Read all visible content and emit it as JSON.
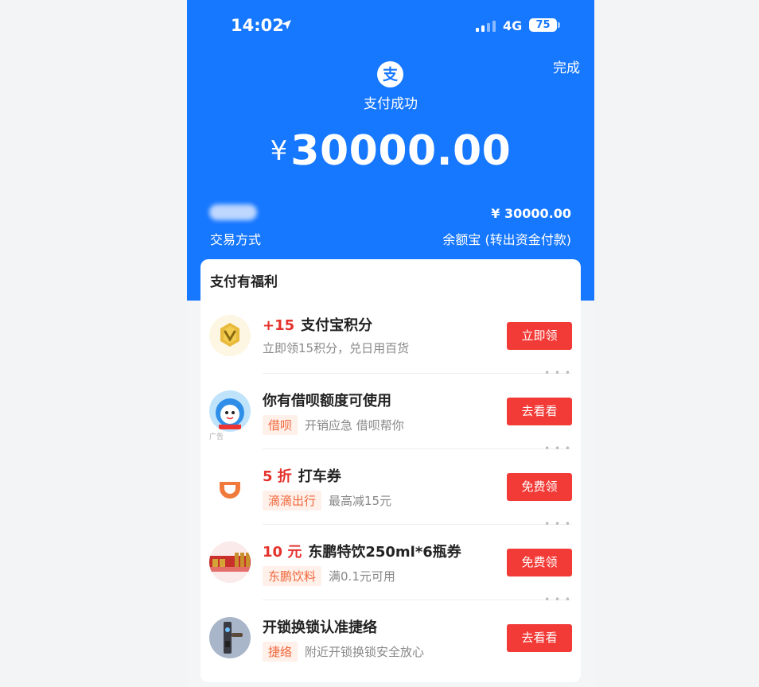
{
  "status_bar": {
    "time": "14:02",
    "network": "4G",
    "battery": "75"
  },
  "header": {
    "done_label": "完成",
    "logo_glyph": "支",
    "title": "支付成功",
    "currency": "¥",
    "amount": "30000.00"
  },
  "transaction": {
    "method_label": "交易方式",
    "amount": "¥ 30000.00",
    "method": "余额宝 (转出资金付款)"
  },
  "benefits": {
    "title": "支付有福利",
    "items": [
      {
        "highlight": "+15",
        "title": "支付宝积分",
        "tag": "",
        "desc": "立即领15积分，兑日用百货",
        "button": "立即领",
        "icon": "gold-coin-icon"
      },
      {
        "highlight": "",
        "title": "你有借呗额度可使用",
        "tag": "借呗",
        "desc": "开销应急 借呗帮你",
        "button": "去看看",
        "icon": "mascot-icon",
        "ad": "广告"
      },
      {
        "highlight": "5 折",
        "title": "打车券",
        "tag": "滴滴出行",
        "desc": "最高减15元",
        "button": "免费领",
        "icon": "didi-logo-icon"
      },
      {
        "highlight": "10 元",
        "title": "东鹏特饮250ml*6瓶券",
        "tag": "东鹏饮料",
        "desc": "满0.1元可用",
        "button": "免费领",
        "icon": "drinks-icon"
      },
      {
        "highlight": "",
        "title": "开锁换锁认准捷络",
        "tag": "捷络",
        "desc": "附近开锁换锁安全放心",
        "button": "去看看",
        "icon": "door-lock-icon"
      }
    ]
  },
  "colors": {
    "brand_blue": "#1677ff",
    "action_red": "#f23a36",
    "highlight_red": "#e5322d",
    "tag_orange": "#f0673a"
  }
}
